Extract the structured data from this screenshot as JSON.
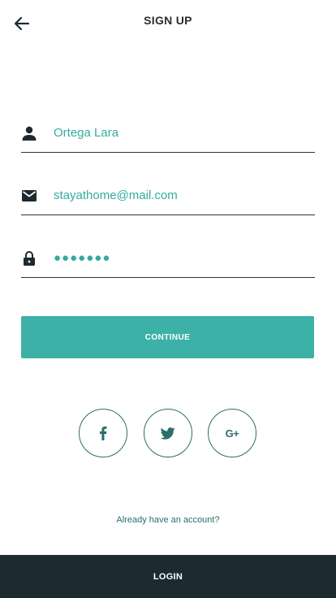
{
  "header": {
    "title": "SIGN UP",
    "back_icon": "arrow-left-icon"
  },
  "form": {
    "name": {
      "icon": "person-icon",
      "value": "Ortega Lara"
    },
    "email": {
      "icon": "mail-icon",
      "value": "stayathome@mail.com"
    },
    "password": {
      "icon": "lock-icon",
      "value": "●●●●●●●"
    },
    "continue_label": "CONTINUE"
  },
  "social": {
    "facebook_icon": "facebook-icon",
    "twitter_icon": "twitter-icon",
    "google_plus_label": "G+"
  },
  "already_account_text": "Already have an account?",
  "footer": {
    "login_label": "LOGIN"
  },
  "colors": {
    "accent": "#3db1a7",
    "input_text": "#35aaa0",
    "dark": "#1d2a30",
    "social_border": "#2a6f6c"
  }
}
